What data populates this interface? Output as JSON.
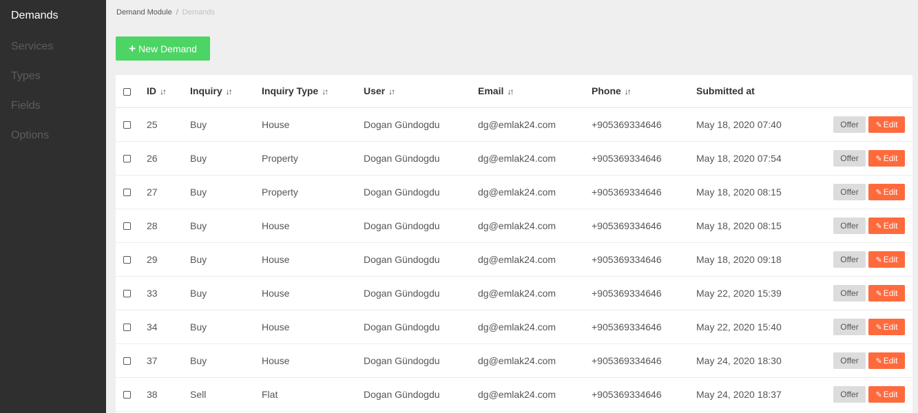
{
  "sidebar": {
    "items": [
      {
        "label": "Demands",
        "active": true
      },
      {
        "label": "Services"
      },
      {
        "label": "Types"
      },
      {
        "label": "Fields"
      },
      {
        "label": "Options"
      }
    ]
  },
  "breadcrumb": {
    "parent": "Demand Module",
    "separator": "/",
    "current": "Demands"
  },
  "toolbar": {
    "new_label": "New Demand"
  },
  "table": {
    "columns": [
      "ID",
      "Inquiry",
      "Inquiry Type",
      "User",
      "Email",
      "Phone",
      "Submitted at"
    ],
    "rows": [
      {
        "id": "25",
        "inquiry": "Buy",
        "type": "House",
        "user": "Dogan Gündogdu",
        "email": "dg@emlak24.com",
        "phone": "+905369334646",
        "submitted": "May 18, 2020 07:40"
      },
      {
        "id": "26",
        "inquiry": "Buy",
        "type": "Property",
        "user": "Dogan Gündogdu",
        "email": "dg@emlak24.com",
        "phone": "+905369334646",
        "submitted": "May 18, 2020 07:54"
      },
      {
        "id": "27",
        "inquiry": "Buy",
        "type": "Property",
        "user": "Dogan Gündogdu",
        "email": "dg@emlak24.com",
        "phone": "+905369334646",
        "submitted": "May 18, 2020 08:15"
      },
      {
        "id": "28",
        "inquiry": "Buy",
        "type": "House",
        "user": "Dogan Gündogdu",
        "email": "dg@emlak24.com",
        "phone": "+905369334646",
        "submitted": "May 18, 2020 08:15"
      },
      {
        "id": "29",
        "inquiry": "Buy",
        "type": "House",
        "user": "Dogan Gündogdu",
        "email": "dg@emlak24.com",
        "phone": "+905369334646",
        "submitted": "May 18, 2020 09:18"
      },
      {
        "id": "33",
        "inquiry": "Buy",
        "type": "House",
        "user": "Dogan Gündogdu",
        "email": "dg@emlak24.com",
        "phone": "+905369334646",
        "submitted": "May 22, 2020 15:39"
      },
      {
        "id": "34",
        "inquiry": "Buy",
        "type": "House",
        "user": "Dogan Gündogdu",
        "email": "dg@emlak24.com",
        "phone": "+905369334646",
        "submitted": "May 22, 2020 15:40"
      },
      {
        "id": "37",
        "inquiry": "Buy",
        "type": "House",
        "user": "Dogan Gündogdu",
        "email": "dg@emlak24.com",
        "phone": "+905369334646",
        "submitted": "May 24, 2020 18:30"
      },
      {
        "id": "38",
        "inquiry": "Sell",
        "type": "Flat",
        "user": "Dogan Gündogdu",
        "email": "dg@emlak24.com",
        "phone": "+905369334646",
        "submitted": "May 24, 2020 18:37"
      }
    ],
    "offer_label": "Offer",
    "edit_label": "Edit"
  },
  "colors": {
    "sidebar_bg": "#2f2f2f",
    "accent_green": "#4cd464",
    "accent_orange": "#ff6a3d",
    "offer_bg": "#dcdcdc"
  },
  "icons": {
    "new": "plus-icon",
    "sort": "sort-icon",
    "edit": "pencil-icon",
    "select": "checkbox-icon"
  }
}
